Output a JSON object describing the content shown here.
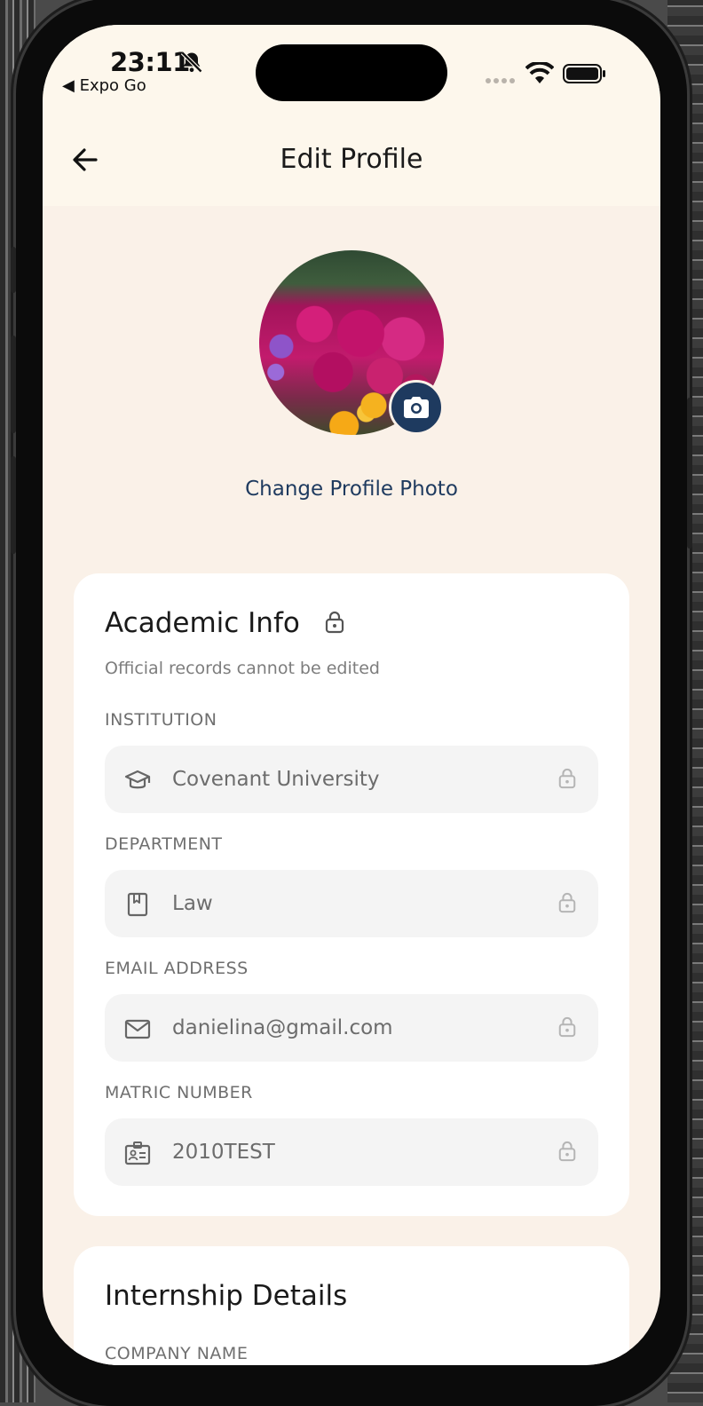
{
  "status_bar": {
    "time": "23:11",
    "back_app": "◀ Expo Go"
  },
  "header": {
    "title": "Edit Profile"
  },
  "profile": {
    "change_photo_label": "Change Profile Photo"
  },
  "academic": {
    "title": "Academic Info",
    "subtitle": "Official records cannot be edited",
    "fields": [
      {
        "label": "INSTITUTION",
        "value": "Covenant University",
        "icon": "graduation-cap-icon"
      },
      {
        "label": "DEPARTMENT",
        "value": "Law",
        "icon": "book-icon"
      },
      {
        "label": "EMAIL ADDRESS",
        "value": "danielina@gmail.com",
        "icon": "mail-icon"
      },
      {
        "label": "MATRIC NUMBER",
        "value": "2010TEST",
        "icon": "id-card-icon"
      }
    ]
  },
  "internship": {
    "title": "Internship Details",
    "first_label": "COMPANY NAME"
  },
  "colors": {
    "accent": "#1e3a5f",
    "screen_bg": "#faf1e8",
    "header_bg": "#fdf7ec",
    "field_bg": "#f4f4f4"
  }
}
